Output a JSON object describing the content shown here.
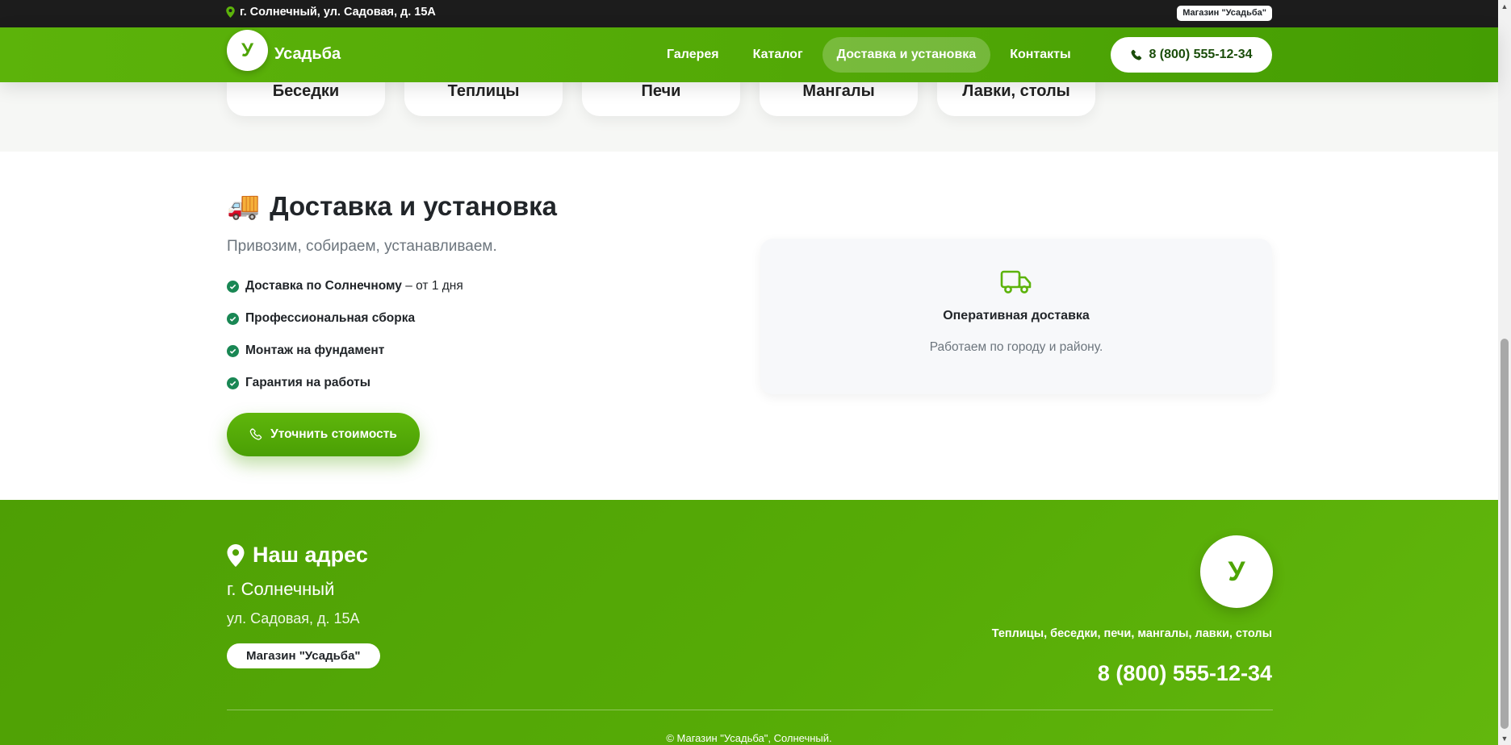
{
  "topbar": {
    "address": "г. Солнечный, ул. Садовая, д. 15А",
    "badge": "Магазин \"Усадьба\"",
    "icon": "map-pin-icon"
  },
  "navbar": {
    "logo_letter": "У",
    "brand_name": "Усадьба",
    "links": [
      {
        "label": "Галерея",
        "active": false
      },
      {
        "label": "Каталог",
        "active": false
      },
      {
        "label": "Доставка и установка",
        "active": true
      },
      {
        "label": "Контакты",
        "active": false
      }
    ],
    "phone": "8 (800) 555-12-34",
    "phone_icon": "phone-icon"
  },
  "categories": [
    "Беседки",
    "Теплицы",
    "Печи",
    "Мангалы",
    "Лавки, столы"
  ],
  "delivery": {
    "emoji": "🚚",
    "title": "Доставка и установка",
    "subtitle": "Привозим, собираем, устанавливаем.",
    "items": [
      {
        "bold": "Доставка по Солнечному",
        "rest": " – от 1 дня"
      },
      {
        "bold": "Профессиональная сборка",
        "rest": ""
      },
      {
        "bold": "Монтаж на фундамент",
        "rest": ""
      },
      {
        "bold": "Гарантия на работы",
        "rest": ""
      }
    ],
    "cta_label": "Уточнить стоимость",
    "card": {
      "icon": "truck-icon",
      "title": "Оперативная доставка",
      "text": "Работаем по городу и району."
    }
  },
  "footer": {
    "title": "Наш адрес",
    "city": "г. Солнечный",
    "street": "ул. Садовая, д. 15А",
    "badge": "Магазин \"Усадьба\"",
    "logo_letter": "У",
    "tagline": "Теплицы, беседки, печи, мангалы, лавки, столы",
    "phone": "8 (800) 555-12-34",
    "copyright": "© Магазин \"Усадьба\", Солнечный."
  },
  "colors": {
    "brand_green": "#52a806",
    "check_green": "#198754",
    "topbar_bg": "#1c1c1c"
  }
}
